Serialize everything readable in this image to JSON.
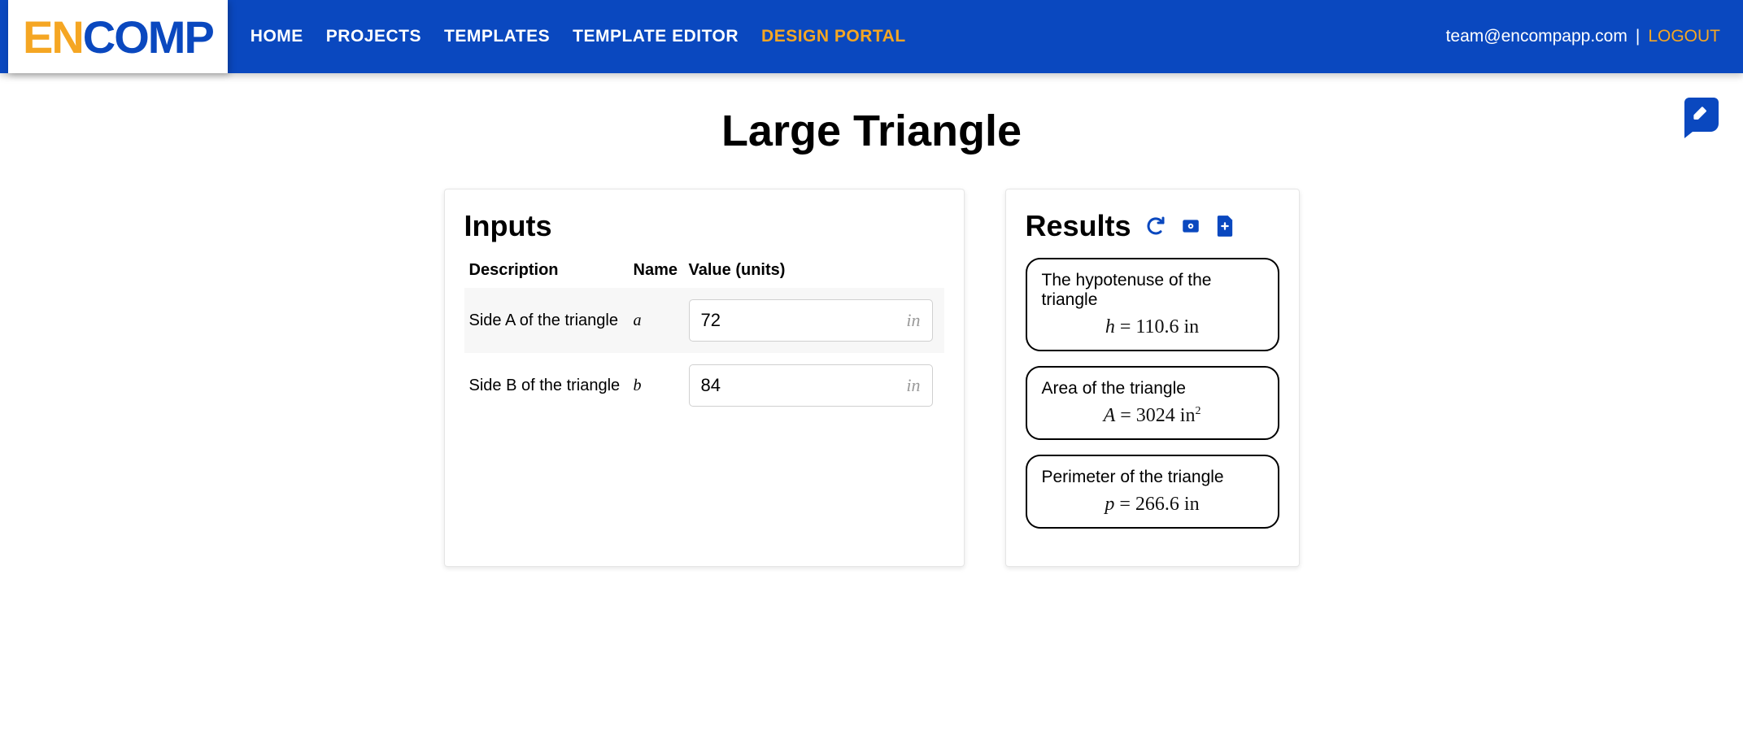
{
  "nav": {
    "links": [
      {
        "label": "HOME",
        "active": false
      },
      {
        "label": "PROJECTS",
        "active": false
      },
      {
        "label": "TEMPLATES",
        "active": false
      },
      {
        "label": "TEMPLATE EDITOR",
        "active": false
      },
      {
        "label": "DESIGN PORTAL",
        "active": true
      }
    ],
    "user_email": "team@encompapp.com",
    "logout_label": "LOGOUT"
  },
  "page": {
    "title": "Large Triangle"
  },
  "inputs": {
    "panel_title": "Inputs",
    "headers": {
      "description": "Description",
      "name": "Name",
      "value": "Value (units)"
    },
    "rows": [
      {
        "description": "Side A of the triangle",
        "name": "a",
        "value": "72",
        "unit": "in"
      },
      {
        "description": "Side B of the triangle",
        "name": "b",
        "value": "84",
        "unit": "in"
      }
    ]
  },
  "results": {
    "panel_title": "Results",
    "items": [
      {
        "label": "The hypotenuse of the triangle",
        "var": "h",
        "value": "110.6",
        "unit": "in",
        "sup": ""
      },
      {
        "label": "Area of the triangle",
        "var": "A",
        "value": "3024",
        "unit": "in",
        "sup": "2"
      },
      {
        "label": "Perimeter of the triangle",
        "var": "p",
        "value": "266.6",
        "unit": "in",
        "sup": ""
      }
    ]
  }
}
